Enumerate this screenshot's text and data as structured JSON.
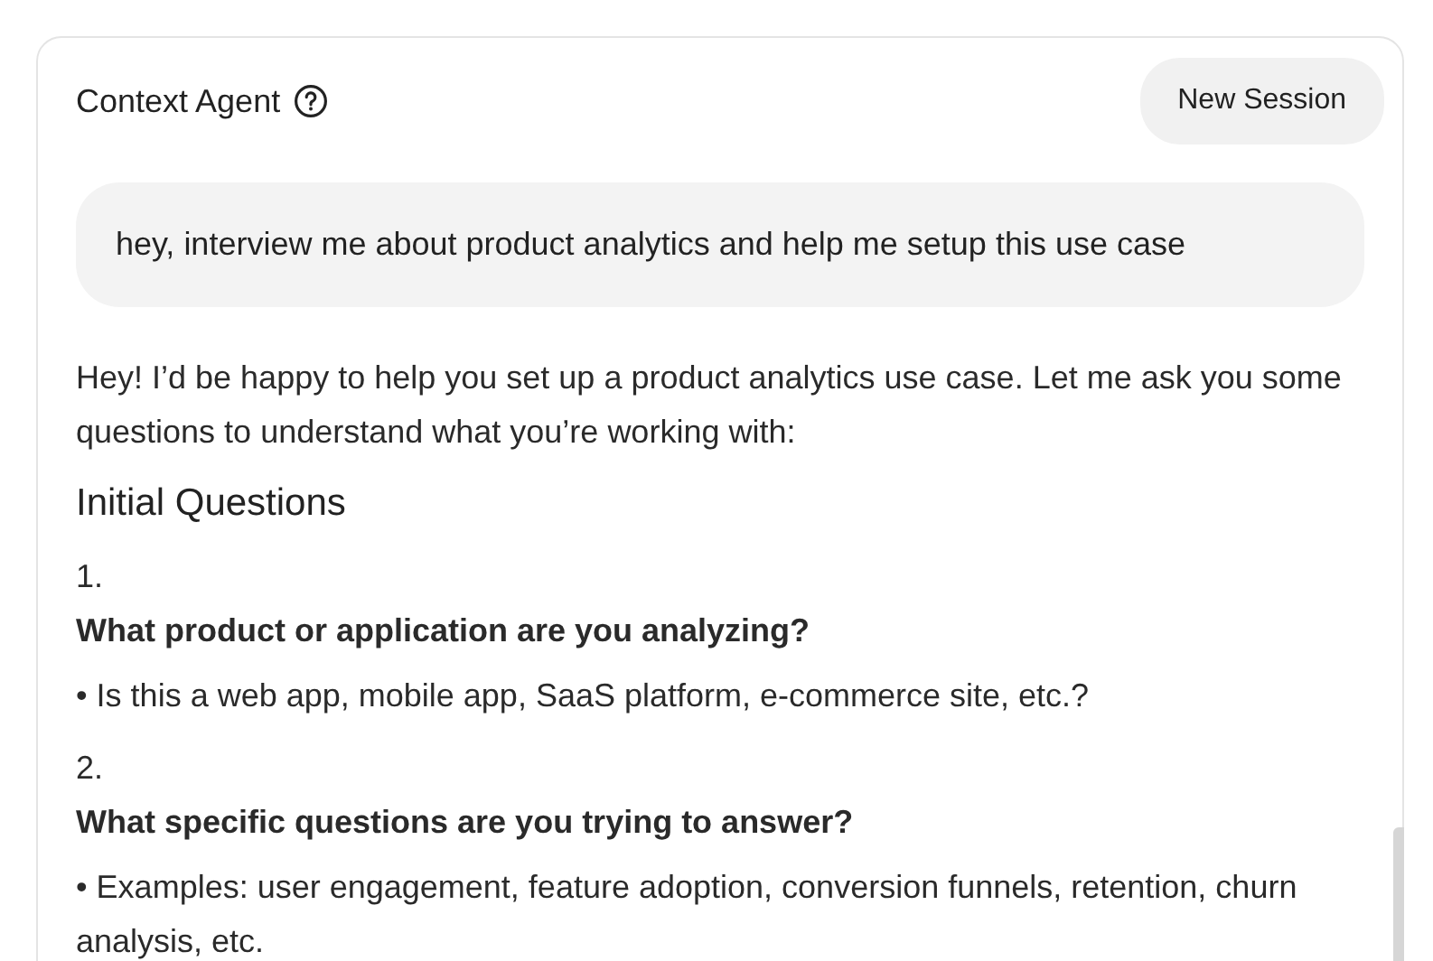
{
  "header": {
    "title": "Context Agent",
    "button": "New Session"
  },
  "user_message": "hey, interview me about product analytics and help me setup this use case",
  "assistant": {
    "intro": "Hey! I’d be happy to help you set up a product analytics use case. Let me ask you some questions to understand what you’re working with:",
    "heading": "Initial Questions",
    "questions": [
      {
        "number": "1.",
        "question": "What product or application are you analyzing?",
        "bullets": [
          "• Is this a web app, mobile app, SaaS platform, e-commerce site, etc.?"
        ]
      },
      {
        "number": "2.",
        "question": "What specific questions are you trying to answer?",
        "bullets": [
          "• Examples: user engagement, feature adoption, conversion funnels, retention, churn analysis, etc."
        ]
      }
    ]
  }
}
